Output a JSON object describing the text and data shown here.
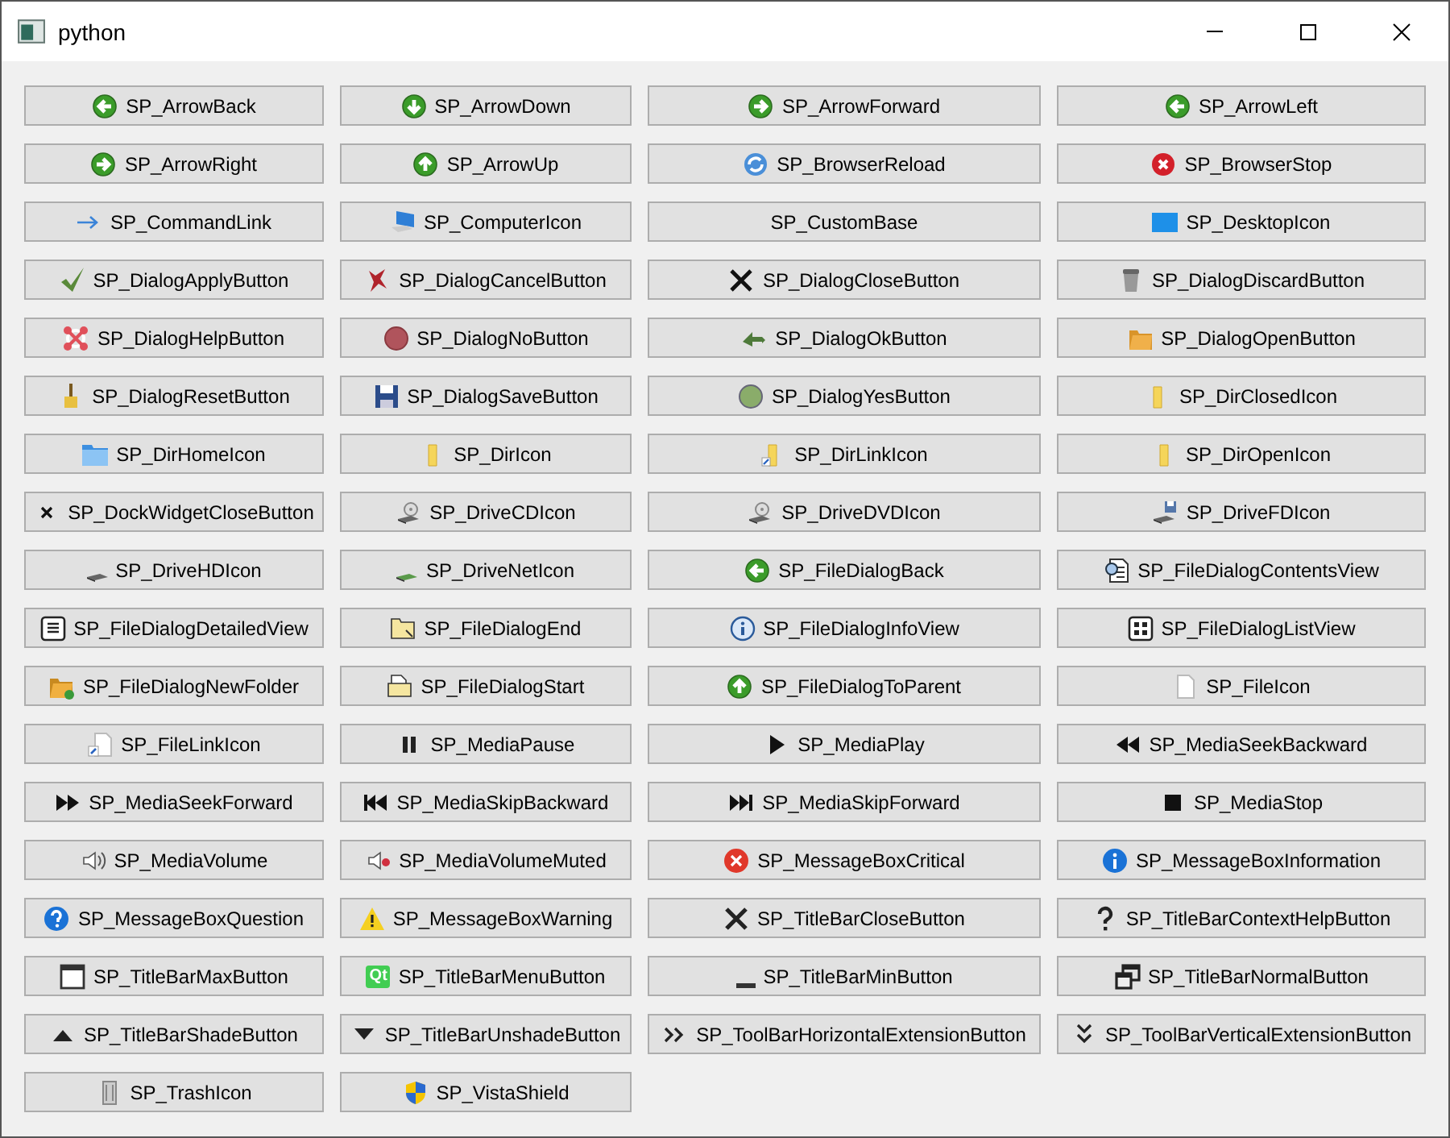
{
  "window": {
    "title": "python"
  },
  "buttons": [
    {
      "label": "SP_ArrowBack"
    },
    {
      "label": "SP_ArrowDown"
    },
    {
      "label": "SP_ArrowForward"
    },
    {
      "label": "SP_ArrowLeft"
    },
    {
      "label": "SP_ArrowRight"
    },
    {
      "label": "SP_ArrowUp"
    },
    {
      "label": "SP_BrowserReload"
    },
    {
      "label": "SP_BrowserStop"
    },
    {
      "label": "SP_CommandLink"
    },
    {
      "label": "SP_ComputerIcon"
    },
    {
      "label": "SP_CustomBase"
    },
    {
      "label": "SP_DesktopIcon"
    },
    {
      "label": "SP_DialogApplyButton"
    },
    {
      "label": "SP_DialogCancelButton"
    },
    {
      "label": "SP_DialogCloseButton"
    },
    {
      "label": "SP_DialogDiscardButton"
    },
    {
      "label": "SP_DialogHelpButton"
    },
    {
      "label": "SP_DialogNoButton"
    },
    {
      "label": "SP_DialogOkButton"
    },
    {
      "label": "SP_DialogOpenButton"
    },
    {
      "label": "SP_DialogResetButton"
    },
    {
      "label": "SP_DialogSaveButton"
    },
    {
      "label": "SP_DialogYesButton"
    },
    {
      "label": "SP_DirClosedIcon"
    },
    {
      "label": "SP_DirHomeIcon"
    },
    {
      "label": "SP_DirIcon"
    },
    {
      "label": "SP_DirLinkIcon"
    },
    {
      "label": "SP_DirOpenIcon"
    },
    {
      "label": "SP_DockWidgetCloseButton"
    },
    {
      "label": "SP_DriveCDIcon"
    },
    {
      "label": "SP_DriveDVDIcon"
    },
    {
      "label": "SP_DriveFDIcon"
    },
    {
      "label": "SP_DriveHDIcon"
    },
    {
      "label": "SP_DriveNetIcon"
    },
    {
      "label": "SP_FileDialogBack"
    },
    {
      "label": "SP_FileDialogContentsView"
    },
    {
      "label": "SP_FileDialogDetailedView"
    },
    {
      "label": "SP_FileDialogEnd"
    },
    {
      "label": "SP_FileDialogInfoView"
    },
    {
      "label": "SP_FileDialogListView"
    },
    {
      "label": "SP_FileDialogNewFolder"
    },
    {
      "label": "SP_FileDialogStart"
    },
    {
      "label": "SP_FileDialogToParent"
    },
    {
      "label": "SP_FileIcon"
    },
    {
      "label": "SP_FileLinkIcon"
    },
    {
      "label": "SP_MediaPause"
    },
    {
      "label": "SP_MediaPlay"
    },
    {
      "label": "SP_MediaSeekBackward"
    },
    {
      "label": "SP_MediaSeekForward"
    },
    {
      "label": "SP_MediaSkipBackward"
    },
    {
      "label": "SP_MediaSkipForward"
    },
    {
      "label": "SP_MediaStop"
    },
    {
      "label": "SP_MediaVolume"
    },
    {
      "label": "SP_MediaVolumeMuted"
    },
    {
      "label": "SP_MessageBoxCritical"
    },
    {
      "label": "SP_MessageBoxInformation"
    },
    {
      "label": "SP_MessageBoxQuestion"
    },
    {
      "label": "SP_MessageBoxWarning"
    },
    {
      "label": "SP_TitleBarCloseButton"
    },
    {
      "label": "SP_TitleBarContextHelpButton"
    },
    {
      "label": "SP_TitleBarMaxButton"
    },
    {
      "label": "SP_TitleBarMenuButton",
      "icon_text": "Qt"
    },
    {
      "label": "SP_TitleBarMinButton"
    },
    {
      "label": "SP_TitleBarNormalButton"
    },
    {
      "label": "SP_TitleBarShadeButton"
    },
    {
      "label": "SP_TitleBarUnshadeButton"
    },
    {
      "label": "SP_ToolBarHorizontalExtensionButton"
    },
    {
      "label": "SP_ToolBarVerticalExtensionButton"
    },
    {
      "label": "SP_TrashIcon"
    },
    {
      "label": "SP_VistaShield"
    }
  ]
}
